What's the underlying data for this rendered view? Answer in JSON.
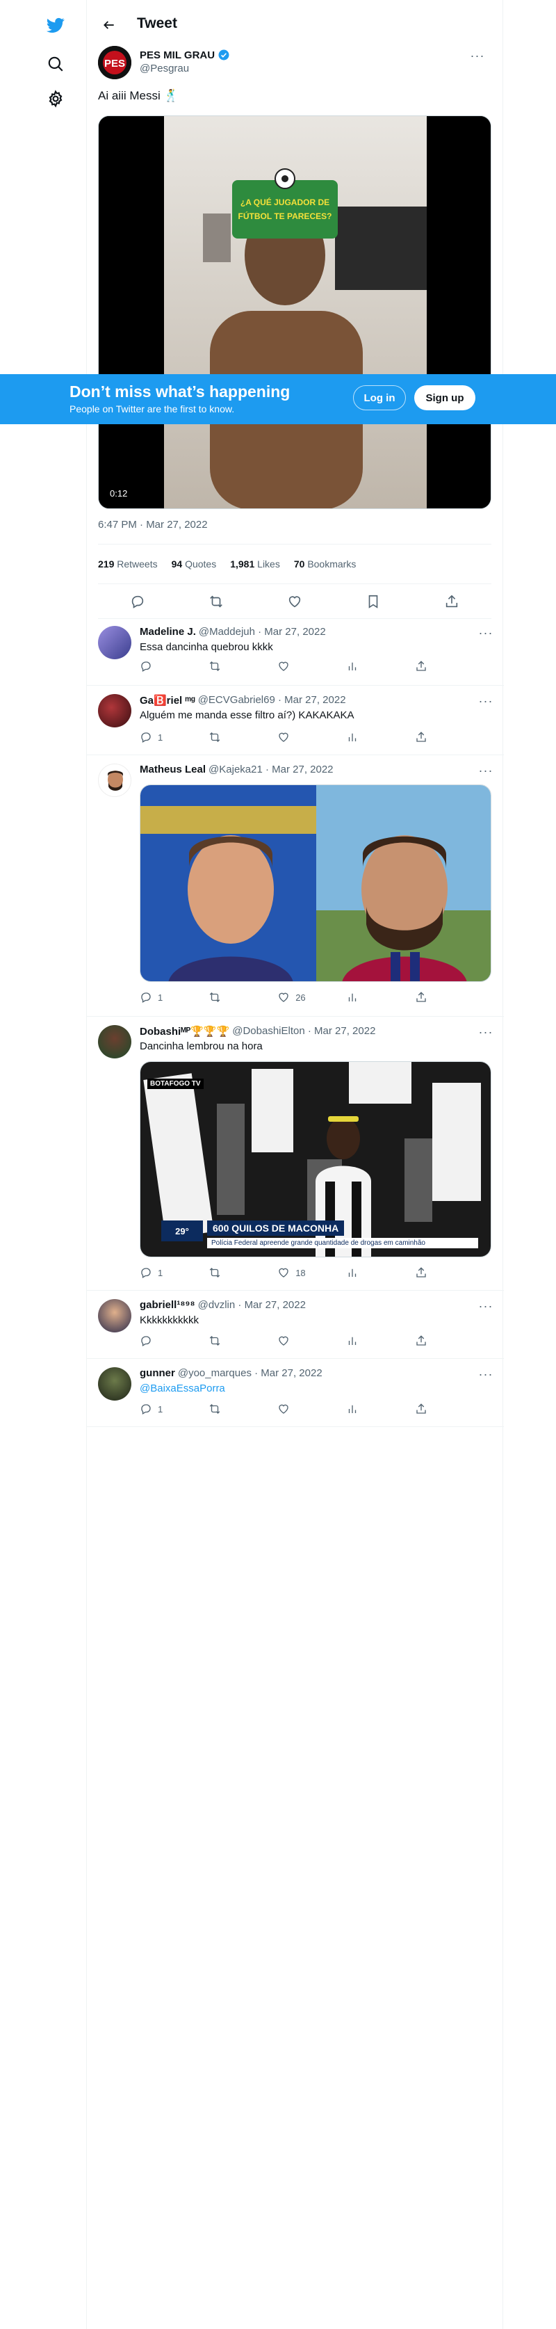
{
  "page": {
    "title": "Tweet"
  },
  "tweet": {
    "author_name": "PES MIL GRAU",
    "handle": "@Pesgrau",
    "text": "Ai aiii Messi 🕺",
    "video_time": "0:12",
    "overlay_text": "¿A QUÉ JUGADOR DE FÚTBOL TE PARECES?",
    "timestamp": "6:47 PM · Mar 27, 2022",
    "stats": {
      "retweets": "219",
      "retweets_label": "Retweets",
      "quotes": "94",
      "quotes_label": "Quotes",
      "likes": "1,981",
      "likes_label": "Likes",
      "bookmarks": "70",
      "bookmarks_label": "Bookmarks"
    }
  },
  "banner": {
    "title": "Don’t miss what’s happening",
    "subtitle": "People on Twitter are the first to know.",
    "login": "Log in",
    "signup": "Sign up"
  },
  "replies": [
    {
      "name": "Madeline J.",
      "meta": "@Maddejuh · Mar 27, 2022",
      "text": "Essa dancinha quebrou kkkk",
      "reply_count": "",
      "like_count": ""
    },
    {
      "name": "Ga🅱️riel ᵐᵍ",
      "meta": "@ECVGabriel69 · Mar 27, 2022",
      "text": "Alguém me manda esse filtro aí?) KAKAKAKA",
      "reply_count": "1",
      "like_count": ""
    },
    {
      "name": "Matheus Leal",
      "meta": "@Kajeka21 · Mar 27, 2022",
      "text": "",
      "reply_count": "1",
      "like_count": "26"
    },
    {
      "name": "Dobashiᴹᴾ🏆🏆🏆",
      "meta": "@DobashiElton · Mar 27, 2022",
      "text": "Dancinha lembrou na hora",
      "reply_count": "1",
      "like_count": "18",
      "media_headline": "600 QUILOS DE MACONHA",
      "media_sub": "Polícia Federal apreende grande quantidade de drogas em caminhão",
      "media_temp": "29°",
      "media_channel": "BOTAFOGO TV"
    },
    {
      "name": "gabriell¹⁸⁹⁸",
      "meta": "@dvzlin · Mar 27, 2022",
      "text": "Kkkkkkkkkkk",
      "reply_count": "",
      "like_count": ""
    },
    {
      "name": "gunner",
      "meta": "@yoo_marques · Mar 27, 2022",
      "text": "@BaixaEssaPorra",
      "reply_count": "1",
      "like_count": ""
    }
  ],
  "colors": {
    "accent": "#1d9bf0",
    "text": "#0f1419",
    "muted": "#536471"
  }
}
